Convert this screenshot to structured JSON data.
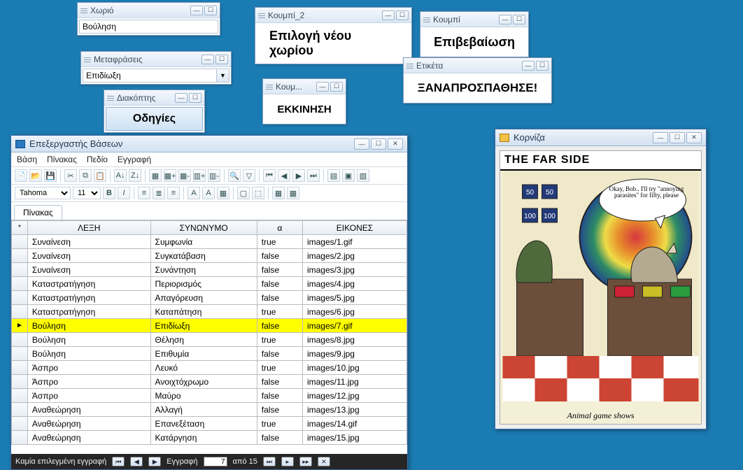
{
  "windows": {
    "xorio": {
      "title": "Χωριό",
      "value": "Βούληση"
    },
    "metafraseis": {
      "title": "Μεταφράσεις",
      "value": "Επιδίωξη"
    },
    "diakoptis": {
      "title": "Διακόπτης",
      "button": "Οδηγίες"
    },
    "koum": {
      "title": "Κουμ...",
      "button": "ΕΚΚΙΝΗΣΗ"
    },
    "koumpi2": {
      "title": "Κουμπί_2",
      "button": "Επιλογή νέου χωρίου"
    },
    "koumpi": {
      "title": "Κουμπί",
      "button": "Επιβεβαίωση"
    },
    "etiketa": {
      "title": "Ετικέτα",
      "text": "ΞΑΝΑΠΡΟΣΠΑΘΗΣΕ!"
    },
    "korniza": {
      "title": "Κορνίζα",
      "comic_title": "THE FAR SIDE",
      "caption": "Animal game shows",
      "bubble": "Okay, Bob.. I'll try \"annoying parasites\" for fifty, please"
    }
  },
  "db": {
    "title": "Επεξεργαστής Βάσεων",
    "menu": [
      "Βάση",
      "Πίνακας",
      "Πεδίο",
      "Εγγραφή"
    ],
    "font_name": "Tahoma",
    "font_size": "11",
    "tab": "Πίνακας",
    "columns": [
      "ΛΕΞΗ",
      "ΣΥΝΩΝΥΜΟ",
      "α",
      "ΕΙΚΟΝΕΣ"
    ],
    "asterisk": "*",
    "rowmark": "►",
    "selected_index": 6,
    "rows": [
      [
        "Συναίνεση",
        "Συμφωνία",
        "true",
        "images/1.gif"
      ],
      [
        "Συναίνεση",
        "Συγκατάβαση",
        "false",
        "images/2.jpg"
      ],
      [
        "Συναίνεση",
        "Συνάντηση",
        "false",
        "images/3.jpg"
      ],
      [
        "Καταστρατήγηση",
        "Περιορισμός",
        "false",
        "images/4.jpg"
      ],
      [
        "Καταστρατήγηση",
        "Απαγόρευση",
        "false",
        "images/5.jpg"
      ],
      [
        "Καταστρατήγηση",
        "Καταπάτηση",
        "true",
        "images/6.jpg"
      ],
      [
        "Βούληση",
        "Επιδίωξη",
        "false",
        "images/7.gif"
      ],
      [
        "Βούληση",
        "Θέληση",
        "true",
        "images/8.jpg"
      ],
      [
        "Βούληση",
        "Επιθυμία",
        "false",
        "images/9.jpg"
      ],
      [
        "Άσπρο",
        "Λευκό",
        "true",
        "images/10.jpg"
      ],
      [
        "Άσπρο",
        "Ανοιχτόχρωμο",
        "false",
        "images/11.jpg"
      ],
      [
        "Άσπρο",
        "Μαύρο",
        "false",
        "images/12.jpg"
      ],
      [
        "Αναθεώρηση",
        "Αλλαγή",
        "false",
        "images/13.jpg"
      ],
      [
        "Αναθεώρηση",
        "Επανεξέταση",
        "true",
        "images/14.gif"
      ],
      [
        "Αναθεώρηση",
        "Κατάργηση",
        "false",
        "images/15.jpg"
      ]
    ],
    "status": {
      "left": "Καμία επιλεγμένη εγγραφή",
      "rec_label": "Εγγραφή",
      "rec_value": "7",
      "rec_of": "από 15"
    }
  }
}
